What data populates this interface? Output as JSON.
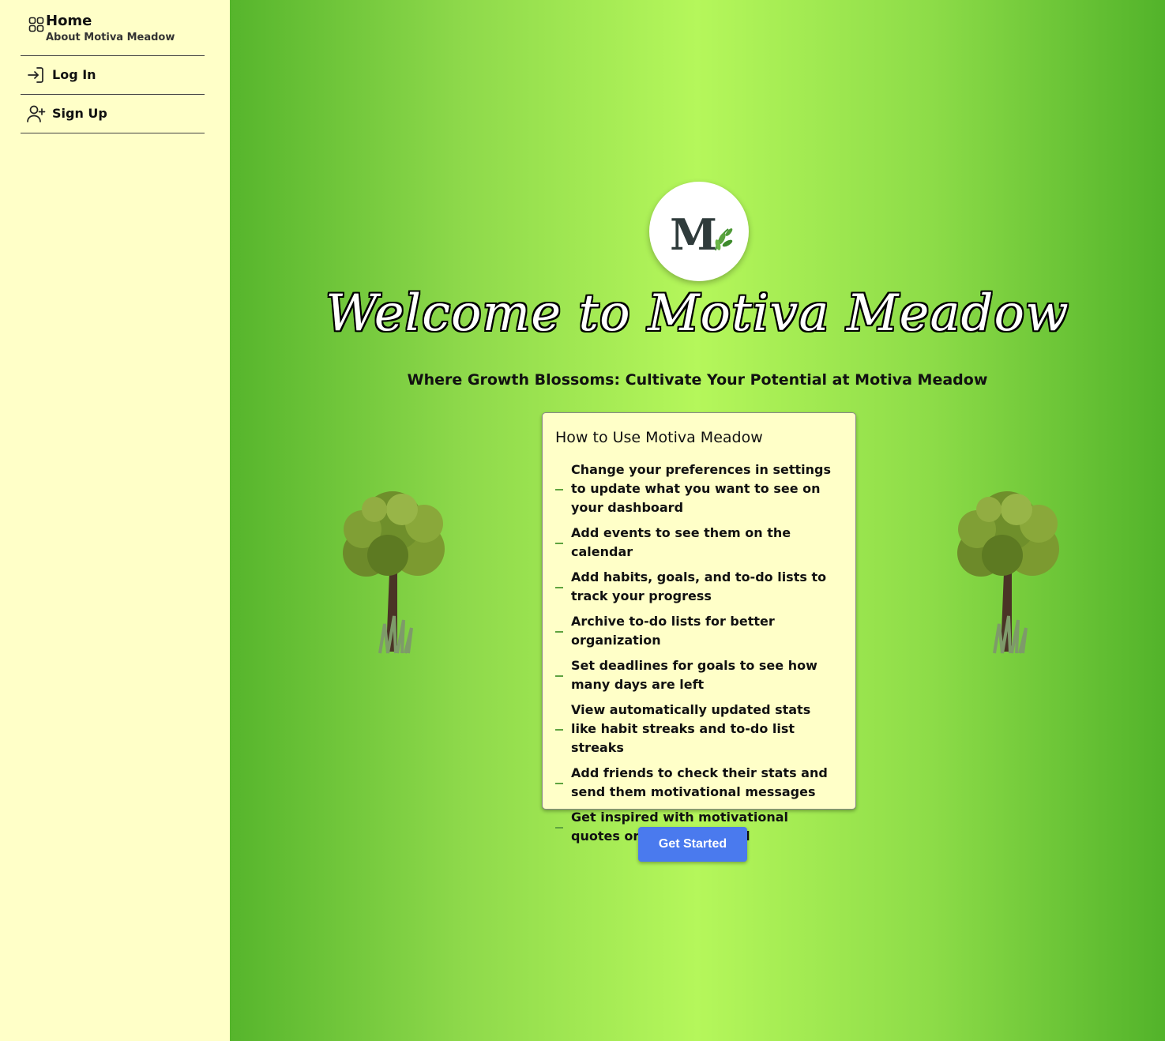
{
  "sidebar": {
    "home_label": "Home",
    "home_sub": "About Motiva Meadow",
    "home_icon": "grid-icon",
    "items": [
      {
        "label": "Log In",
        "icon": "login-icon"
      },
      {
        "label": "Sign Up",
        "icon": "user-plus-icon"
      }
    ],
    "background": "#ffffc8"
  },
  "main": {
    "logo_letter": "M",
    "welcome": "Welcome to Motiva Meadow",
    "subtitle": "Where Growth Blossoms: Cultivate Your Potential at Motiva Meadow",
    "card": {
      "title": "How to Use Motiva Meadow",
      "items": [
        "Change your preferences in settings to update what you want to see on your dashboard",
        "Add events to see them on the calendar",
        "Add habits, goals, and to-do lists to track your progress",
        "Archive to-do lists for better organization",
        "Set deadlines for goals to see how many days are left",
        "View automatically updated stats like habit streaks and to-do list streaks",
        "Add friends to check their stats and send them motivational messages",
        "Get inspired with motivational quotes on the dashboard"
      ]
    },
    "cta_label": "Get Started",
    "colors": {
      "accent": "#4a7aee",
      "green": "#b5f75b",
      "card": "#ffffc8"
    }
  }
}
